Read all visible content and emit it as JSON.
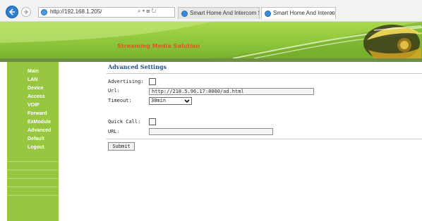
{
  "browser": {
    "url": "http://192.168.1.205/",
    "address_tools": "⌕ ▾ ⊠ ↻",
    "tabs": [
      {
        "label": "Smart Home And Intercom Sys..."
      },
      {
        "label": "Smart Home And Intercom ..."
      }
    ],
    "close_glyph": "×"
  },
  "banner": {
    "title": "Streaming Media Solution"
  },
  "sidebar": {
    "items": [
      {
        "label": "Main"
      },
      {
        "label": "LAN"
      },
      {
        "label": "Device"
      },
      {
        "label": "Access"
      },
      {
        "label": "VOIP"
      },
      {
        "label": "Forward"
      },
      {
        "label": "ExModule"
      },
      {
        "label": "Advanced"
      },
      {
        "label": "Default"
      },
      {
        "label": "Logout"
      }
    ]
  },
  "main": {
    "title": "Advanced Settings",
    "advertising_label": "Advertising:",
    "url_label": "Url:",
    "url_value": "http://218.5.96.17:8000/ad.html",
    "timeout_label": "Timeout:",
    "timeout_value": "30min",
    "quick_call_label": "Quick Call:",
    "quick_url_label": "URL:",
    "quick_url_value": "",
    "submit_label": "Submit"
  },
  "colors": {
    "sidebar": "#97c740",
    "banner": "#8cc43a",
    "banner_text": "#e05a20",
    "title_text": "#1d4f8a"
  }
}
